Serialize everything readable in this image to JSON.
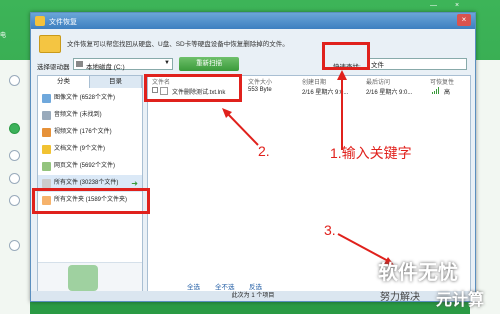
{
  "background_app": {
    "label": "电",
    "controls": [
      "—",
      "×"
    ]
  },
  "dialog": {
    "title": "文件恢复",
    "close": "×",
    "description": "文件恢复可以帮您找回从硬盘、U盘、SD卡等硬盘设备中恢复删除掉的文件。",
    "drive_label": "选择驱动器",
    "drive_value": "本地磁盘 (C:)",
    "rescan_button": "重新扫描",
    "search_label": "快速查找:",
    "search_value": "文件",
    "tabs": [
      "分类",
      "目录"
    ],
    "categories": [
      {
        "label": "图像文件 (6528个文件)",
        "color": "#6fa8dc"
      },
      {
        "label": "音频文件 (未找到)",
        "color": "#9ab"
      },
      {
        "label": "视频文件 (176个文件)",
        "color": "#e69138"
      },
      {
        "label": "文档文件 (9个文件)",
        "color": "#f1c232"
      },
      {
        "label": "网页文件 (5692个文件)",
        "color": "#93c47d"
      },
      {
        "label": "所有文件 (30238个文件)",
        "color": "#cccccc"
      },
      {
        "label": "所有文件夹 (1589个文件夹)",
        "color": "#f6b26b"
      }
    ],
    "file_columns": [
      "文件名",
      "文件大小",
      "创建日期",
      "最后访问",
      "可恢复性"
    ],
    "file_rows": [
      {
        "name": "文件删除测试.txt.lnk",
        "size": "553 Byte",
        "created": "2/16 星期六 9:0...",
        "accessed": "2/16 星期六 9:0...",
        "recover": "高"
      }
    ],
    "bottom_links": [
      "全选",
      "全不选",
      "反选"
    ],
    "status": "此次为 1 个项目"
  },
  "annotations": {
    "step1": "1.输入关键字",
    "step2": "2.",
    "step3": "3."
  },
  "watermark": {
    "line1": "软件无忧",
    "line2": "努力解决",
    "line3": "元计算"
  }
}
